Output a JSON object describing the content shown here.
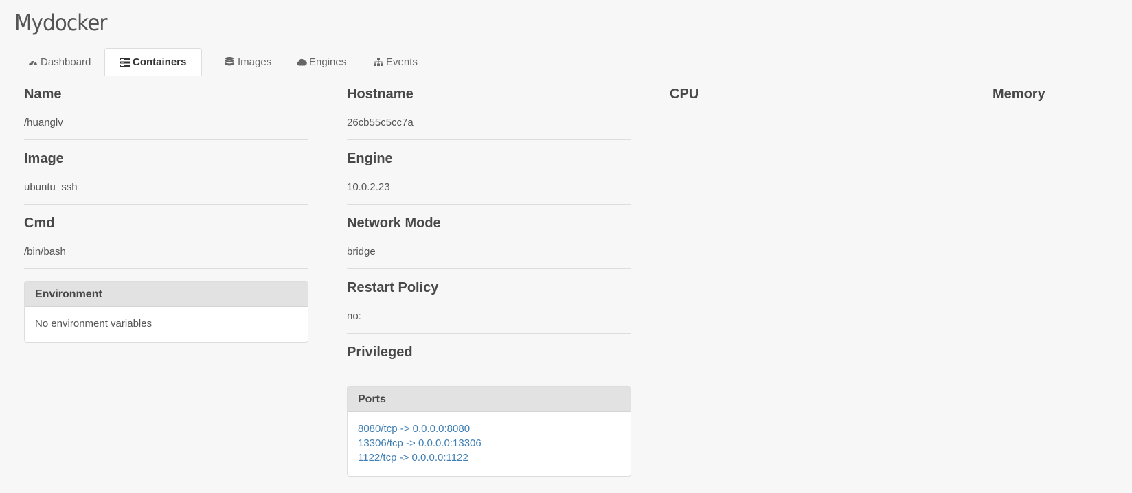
{
  "brand": "Mydocker",
  "tabs": [
    {
      "label": "Dashboard",
      "icon": "dashboard-icon"
    },
    {
      "label": "Containers",
      "icon": "containers-icon",
      "active": true
    },
    {
      "label": "Images",
      "icon": "database-icon"
    },
    {
      "label": "Engines",
      "icon": "cloud-icon"
    },
    {
      "label": "Events",
      "icon": "sitemap-icon"
    }
  ],
  "left": {
    "name_label": "Name",
    "name_value": "/huanglv",
    "image_label": "Image",
    "image_value": "ubuntu_ssh",
    "cmd_label": "Cmd",
    "cmd_value": "/bin/bash",
    "env_title": "Environment",
    "env_empty": "No environment variables"
  },
  "middle": {
    "hostname_label": "Hostname",
    "hostname_value": "26cb55c5cc7a",
    "engine_label": "Engine",
    "engine_value": "10.0.2.23",
    "network_label": "Network Mode",
    "network_value": "bridge",
    "restart_label": "Restart Policy",
    "restart_value": "no:",
    "privileged_label": "Privileged",
    "ports_title": "Ports",
    "ports": [
      "8080/tcp -> 0.0.0.0:8080",
      "13306/tcp -> 0.0.0.0:13306",
      "1122/tcp -> 0.0.0.0:1122"
    ]
  },
  "cpu_label": "CPU",
  "memory_label": "Memory",
  "colors": {
    "background": "#f7f7f7",
    "link": "#3f7fb4",
    "panel_header": "#e2e2e2"
  }
}
